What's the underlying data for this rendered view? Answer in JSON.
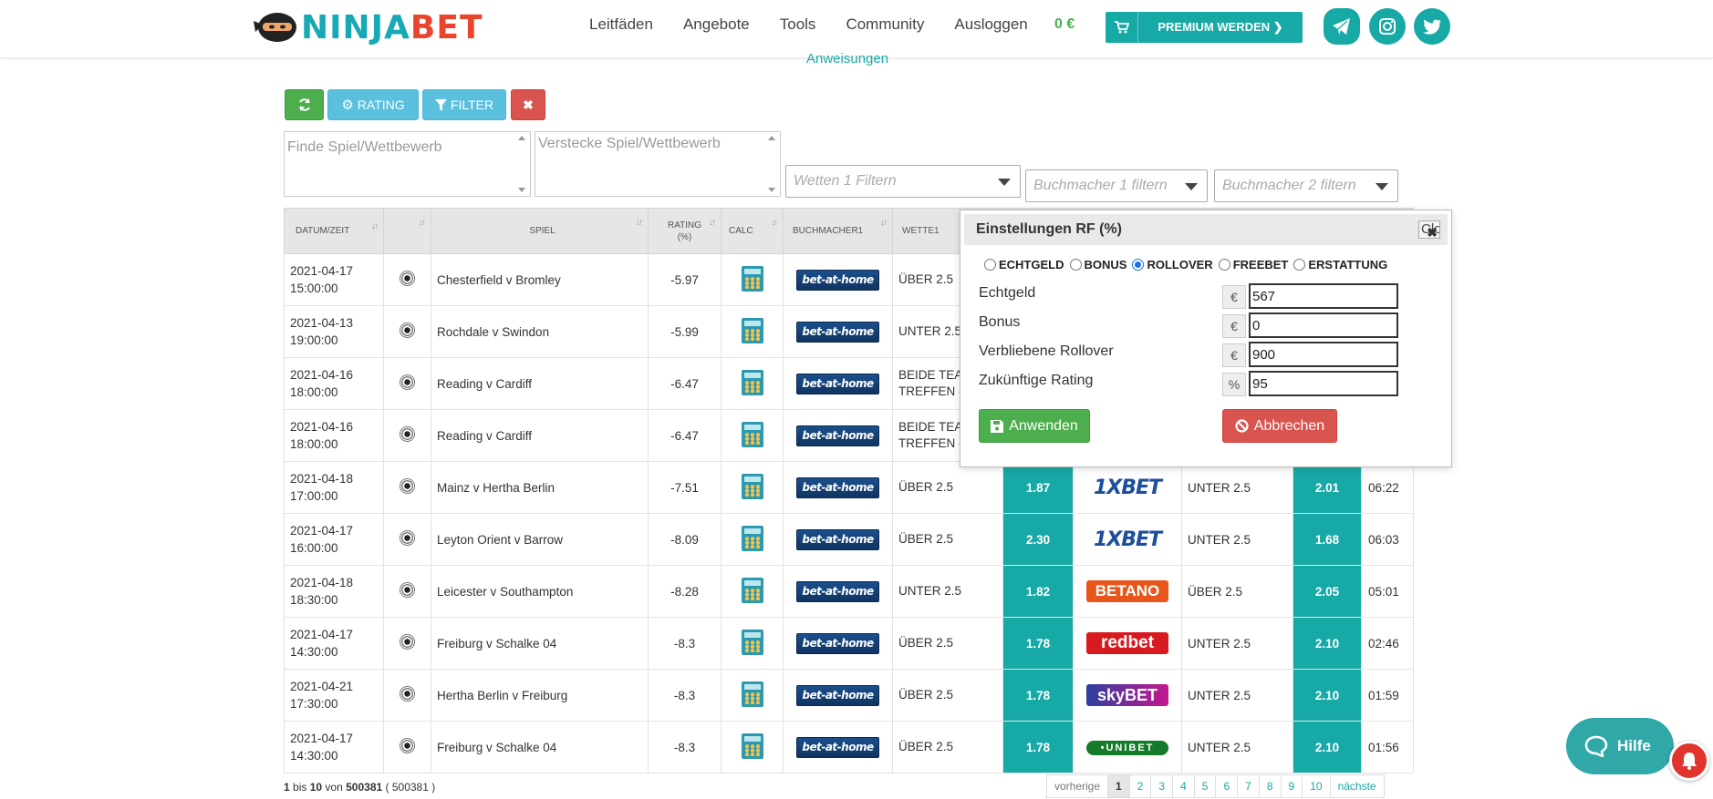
{
  "header": {
    "brand_ninja": "NINJA",
    "brand_bet": "BET",
    "nav": [
      "Leitfäden",
      "Angebote",
      "Tools",
      "Community",
      "Ausloggen"
    ],
    "balance": "0 €",
    "premium_label": "PREMIUM WERDEN ❯",
    "instructions_link": "Anweisungen"
  },
  "toolbar": {
    "rating_label": "RATING",
    "filter_label": "FILTER"
  },
  "filters": {
    "find_placeholder": "Finde Spiel/Wettbewerb",
    "hide_placeholder": "Verstecke Spiel/Wettbewerb",
    "bets1": "Wetten 1 Filtern",
    "bookmaker1": "Buchmacher 1 filtern",
    "bookmaker2": "Buchmacher 2 filtern"
  },
  "table": {
    "headers": {
      "date": "DATUM/ZEIT",
      "ball": "",
      "match": "SPIEL",
      "rating": "RATING (%)",
      "calc": "CALC",
      "bookmaker1": "BUCHMACHER1",
      "bet1": "WETTE1"
    },
    "rows": [
      {
        "date": "2021-04-17",
        "time": "15:00:00",
        "match": "Chesterfield v Bromley",
        "rating": "-5.97",
        "bm1": "bet-at-home",
        "bet1": "ÜBER 2.5",
        "odd1": "",
        "bm2": "",
        "bet2": "",
        "odd2": "",
        "left": ""
      },
      {
        "date": "2021-04-13",
        "time": "19:00:00",
        "match": "Rochdale v Swindon",
        "rating": "-5.99",
        "bm1": "bet-at-home",
        "bet1": "UNTER 2.5",
        "odd1": "",
        "bm2": "",
        "bet2": "",
        "odd2": "",
        "left": ""
      },
      {
        "date": "2021-04-16",
        "time": "18:00:00",
        "match": "Reading v Cardiff",
        "rating": "-6.47",
        "bm1": "bet-at-home",
        "bet1": "BEIDE TEA TREFFEN -",
        "odd1": "",
        "bm2": "",
        "bet2": "",
        "odd2": "",
        "left": ""
      },
      {
        "date": "2021-04-16",
        "time": "18:00:00",
        "match": "Reading v Cardiff",
        "rating": "-6.47",
        "bm1": "bet-at-home",
        "bet1": "BEIDE TEA TREFFEN -",
        "odd1": "",
        "bm2": "",
        "bet2": "",
        "odd2": "",
        "left": ""
      },
      {
        "date": "2021-04-18",
        "time": "17:00:00",
        "match": "Mainz v Hertha Berlin",
        "rating": "-7.51",
        "bm1": "bet-at-home",
        "bet1": "ÜBER 2.5",
        "odd1": "1.87",
        "bm2": "1XBET",
        "bet2": "UNTER 2.5",
        "odd2": "2.01",
        "left": "06:22"
      },
      {
        "date": "2021-04-17",
        "time": "16:00:00",
        "match": "Leyton Orient v Barrow",
        "rating": "-8.09",
        "bm1": "bet-at-home",
        "bet1": "ÜBER 2.5",
        "odd1": "2.30",
        "bm2": "1XBET",
        "bet2": "UNTER 2.5",
        "odd2": "1.68",
        "left": "06:03"
      },
      {
        "date": "2021-04-18",
        "time": "18:30:00",
        "match": "Leicester v Southampton",
        "rating": "-8.28",
        "bm1": "bet-at-home",
        "bet1": "UNTER 2.5",
        "odd1": "1.82",
        "bm2": "BETANO",
        "bet2": "ÜBER 2.5",
        "odd2": "2.05",
        "left": "05:01"
      },
      {
        "date": "2021-04-17",
        "time": "14:30:00",
        "match": "Freiburg v Schalke 04",
        "rating": "-8.3",
        "bm1": "bet-at-home",
        "bet1": "ÜBER 2.5",
        "odd1": "1.78",
        "bm2": "redbet",
        "bet2": "UNTER 2.5",
        "odd2": "2.10",
        "left": "02:46"
      },
      {
        "date": "2021-04-21",
        "time": "17:30:00",
        "match": "Hertha Berlin v Freiburg",
        "rating": "-8.3",
        "bm1": "bet-at-home",
        "bet1": "ÜBER 2.5",
        "odd1": "1.78",
        "bm2": "skyBET",
        "bet2": "UNTER 2.5",
        "odd2": "2.10",
        "left": "01:59"
      },
      {
        "date": "2021-04-17",
        "time": "14:30:00",
        "match": "Freiburg v Schalke 04",
        "rating": "-8.3",
        "bm1": "bet-at-home",
        "bet1": "ÜBER 2.5",
        "odd1": "1.78",
        "bm2": "•UNIBET",
        "bet2": "UNTER 2.5",
        "odd2": "2.10",
        "left": "01:56"
      }
    ]
  },
  "footer": {
    "from": "1",
    "word_to": "bis",
    "to": "10",
    "word_of": "von",
    "total": "500381",
    "total_paren": "( 500381 )"
  },
  "pager": {
    "prev": "vorherige",
    "pages": [
      "1",
      "2",
      "3",
      "4",
      "5",
      "6",
      "7",
      "8",
      "9",
      "10"
    ],
    "next": "nächste",
    "active": "1"
  },
  "modal": {
    "title": "Einstellungen RF (%)",
    "close_label": "Close",
    "radios": [
      {
        "label": "ECHTGELD",
        "checked": false
      },
      {
        "label": "BONUS",
        "checked": false
      },
      {
        "label": "ROLLOVER",
        "checked": true
      },
      {
        "label": "FREEBET",
        "checked": false
      },
      {
        "label": "ERSTATTUNG",
        "checked": false
      }
    ],
    "fields": [
      {
        "label": "Echtgeld",
        "unit": "€",
        "value": "567"
      },
      {
        "label": "Bonus",
        "unit": "€",
        "value": "0"
      },
      {
        "label": "Verbliebene Rollover",
        "unit": "€",
        "value": "900"
      },
      {
        "label": "Zukünftige Rating",
        "unit": "%",
        "value": "95"
      }
    ],
    "apply_label": "Anwenden",
    "cancel_label": "Abbrechen"
  },
  "help_label": "Hilfe",
  "colors": {
    "teal": "#17a9a6",
    "green": "#4cae4c",
    "red": "#d9534f",
    "info_blue": "#5bc0de"
  }
}
